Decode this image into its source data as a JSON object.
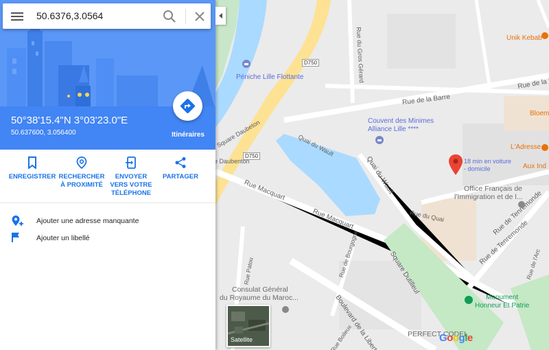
{
  "search": {
    "value": "50.6376,3.0564"
  },
  "place": {
    "title": "50°38'15.4\"N 3°03'23.0\"E",
    "subtitle": "50.637600, 3.056400",
    "directions_label": "Itinéraires"
  },
  "actions": [
    {
      "l1": "ENREGISTRER",
      "l2": "",
      "l3": ""
    },
    {
      "l1": "RECHERCHER",
      "l2": "À PROXIMITÉ",
      "l3": ""
    },
    {
      "l1": "ENVOYER",
      "l2": "VERS VOTRE",
      "l3": "TÉLÉPHONE"
    },
    {
      "l1": "PARTAGER",
      "l2": "",
      "l3": ""
    }
  ],
  "links": {
    "add_address": "Ajouter une adresse manquante",
    "add_label": "Ajouter un libellé"
  },
  "map": {
    "streets": {
      "rue_de_la_barre_1": "Rue de la Barre",
      "rue_de_la_barre_2": "Rue de la Barre",
      "rue_du_gros_gerard": "Rue du Gros Gérard",
      "quai_du_wault_1": "Quai du Wault",
      "quai_du_wault_2": "Quai du Wault",
      "square_daubeton": "Square Daubeton",
      "square_daubenton_cut": "e Daubenton",
      "rue_macquart_1": "Rue Macquart",
      "rue_macquart_2": "Rue Macquart",
      "rue_du_quai": "Rue du Quai",
      "rue_de_bourgogne": "Rue de Bourgogne",
      "square_dutilleul": "Square Dutilleul",
      "rue_de_tenremonde_1": "Rue de Tenremonde",
      "rue_de_tenremonde_2": "Rue de Tenremonde",
      "rue_de_l_arc": "Rue de l'Arc",
      "rue_patou": "Rue Patou",
      "boulevard_de_la_liberte": "Boulevard de la Liberté",
      "rue_boileux": "Rue Boileux",
      "d750_a": "D750",
      "d750_b": "D750"
    },
    "pois": {
      "peniche": "Péniche Lille Flottante",
      "couvent_1": "Couvent des Minimes",
      "couvent_2": "Alliance Lille ****",
      "unik_kebab": "Unik Kebab",
      "bloem": "Bloem",
      "ladresse": "L'Adresse",
      "aux_ind": "Aux Ind",
      "office_1": "Office Français de",
      "office_2": "l'Immigration et de l...",
      "consulat_1": "Consulat Général",
      "consulat_2": "du Royaume du Maroc...",
      "monument_1": "Monument",
      "monument_2": "Honneur Et Patrie",
      "perfect": "PERFECT CODEL"
    },
    "pin_note_1": "18 min en voiture",
    "pin_note_2": "- domicile",
    "satellite_label": "Satellite",
    "logo": [
      "G",
      "o",
      "o",
      "g",
      "l",
      "e"
    ]
  },
  "colors": {
    "header_blue": "#4285f4",
    "action_blue": "#1a73e8",
    "water": "#aadaff",
    "park": "#c5e8c5",
    "highway": "#fde293",
    "pin_red": "#ea4335"
  },
  "icons": [
    "menu-icon",
    "search-icon",
    "close-icon",
    "directions-icon",
    "bookmark-icon",
    "nearby-icon",
    "send-to-phone-icon",
    "share-icon",
    "add-location-icon",
    "flag-icon",
    "collapse-arrow-icon",
    "location-pin-icon"
  ]
}
